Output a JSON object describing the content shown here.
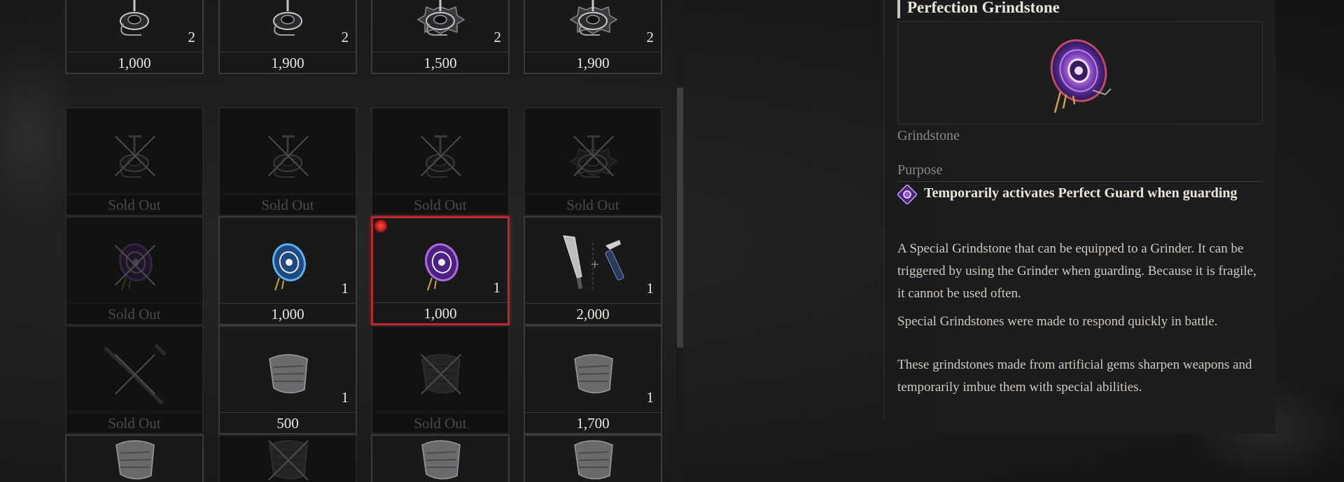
{
  "grid": {
    "rows": [
      [
        {
          "price": "1,000",
          "qty": "2",
          "sold_out": false,
          "icon": "grinder-icon"
        },
        {
          "price": "1,900",
          "qty": "2",
          "sold_out": false,
          "icon": "grinder-icon"
        },
        {
          "price": "1,500",
          "qty": "2",
          "sold_out": false,
          "icon": "spiked-grinder-icon"
        },
        {
          "price": "1,900",
          "qty": "2",
          "sold_out": false,
          "icon": "spiked-grinder-icon"
        }
      ],
      [
        {
          "price": "Sold Out",
          "qty": "",
          "sold_out": true,
          "icon": "grinder-icon"
        },
        {
          "price": "Sold Out",
          "qty": "",
          "sold_out": true,
          "icon": "grinder-icon"
        },
        {
          "price": "Sold Out",
          "qty": "",
          "sold_out": true,
          "icon": "grinder-icon"
        },
        {
          "price": "Sold Out",
          "qty": "",
          "sold_out": true,
          "icon": "spiked-grinder-icon"
        }
      ],
      [
        {
          "price": "Sold Out",
          "qty": "",
          "sold_out": true,
          "icon": "grindstone-icon"
        },
        {
          "price": "1,000",
          "qty": "1",
          "sold_out": false,
          "icon": "blue-grindstone-icon"
        },
        {
          "price": "1,000",
          "qty": "1",
          "sold_out": false,
          "icon": "purple-grindstone-icon",
          "selected": true
        },
        {
          "price": "2,000",
          "qty": "1",
          "sold_out": false,
          "icon": "blade-and-handle-icon"
        }
      ],
      [
        {
          "price": "Sold Out",
          "qty": "",
          "sold_out": true,
          "icon": "weapon-icon"
        },
        {
          "price": "500",
          "qty": "1",
          "sold_out": false,
          "icon": "armor-piece-icon"
        },
        {
          "price": "Sold Out",
          "qty": "",
          "sold_out": true,
          "icon": "armor-piece-icon"
        },
        {
          "price": "1,700",
          "qty": "1",
          "sold_out": false,
          "icon": "armor-piece-icon"
        }
      ],
      [
        {
          "price": "",
          "qty": "",
          "sold_out": false,
          "icon": "armor-piece-icon"
        },
        {
          "price": "",
          "qty": "",
          "sold_out": true,
          "icon": "armor-piece-icon"
        },
        {
          "price": "",
          "qty": "",
          "sold_out": false,
          "icon": "armor-piece-icon"
        },
        {
          "price": "",
          "qty": "",
          "sold_out": false,
          "icon": "armor-piece-icon"
        }
      ]
    ]
  },
  "detail": {
    "title": "Perfection Grindstone",
    "category": "Grindstone",
    "purpose_label": "Purpose",
    "purpose_text": "Temporarily activates Perfect Guard when guarding",
    "description_1": "A Special Grindstone that can be equipped to a Grinder. It can be triggered by using the Grinder when guarding. Because it is fragile, it cannot be used often.",
    "description_2": "Special Grindstones were made to respond quickly in battle.",
    "description_3": "These grindstones made from artificial gems sharpen weapons and temporarily imbue them with special abilities."
  },
  "colors": {
    "selected_border": "#c0262b",
    "grindstone_purple": "#7a3cc8",
    "grindstone_blue": "#3a8ad0"
  }
}
